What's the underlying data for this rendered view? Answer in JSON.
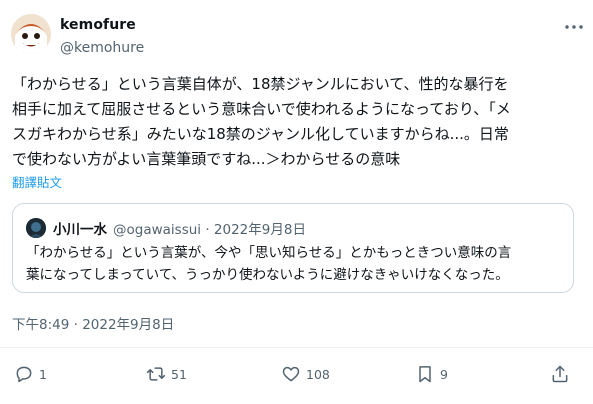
{
  "author": {
    "name": "kemofure",
    "handle": "@kemohure"
  },
  "tweet": {
    "lines": [
      "「わからせる」という言葉自体が、18禁ジャンルにおいて、性的な暴行を",
      "相手に加えて屈服させるという意味合いで使われるようになっており、「メ",
      "スガキわからせ系」みたいな18禁のジャンル化していますからね...。日常",
      "で使わない方がよい言葉筆頭ですね...＞わからせるの意味"
    ],
    "translate_label": "翻譯貼文",
    "timestamp": "下午8:49 · 2022年9月8日"
  },
  "quote": {
    "name": "小川一水",
    "meta": "@ogawaissui · 2022年9月8日",
    "lines": [
      "「わからせる」という言葉が、今や「思い知らせる」とかもっときつい意味の言",
      "葉になってしまっていて、うっかり使わないように避けなきゃいけなくなった。"
    ]
  },
  "actions": {
    "replies": "1",
    "retweets": "51",
    "likes": "108",
    "bookmarks": "9"
  },
  "icons": [
    "more-icon",
    "reply-icon",
    "retweet-icon",
    "like-icon",
    "bookmark-icon",
    "share-icon"
  ],
  "colors": {
    "text": "#0f1419",
    "secondary": "#536471",
    "link": "#1d9bf0",
    "border": "#cfd9de"
  }
}
